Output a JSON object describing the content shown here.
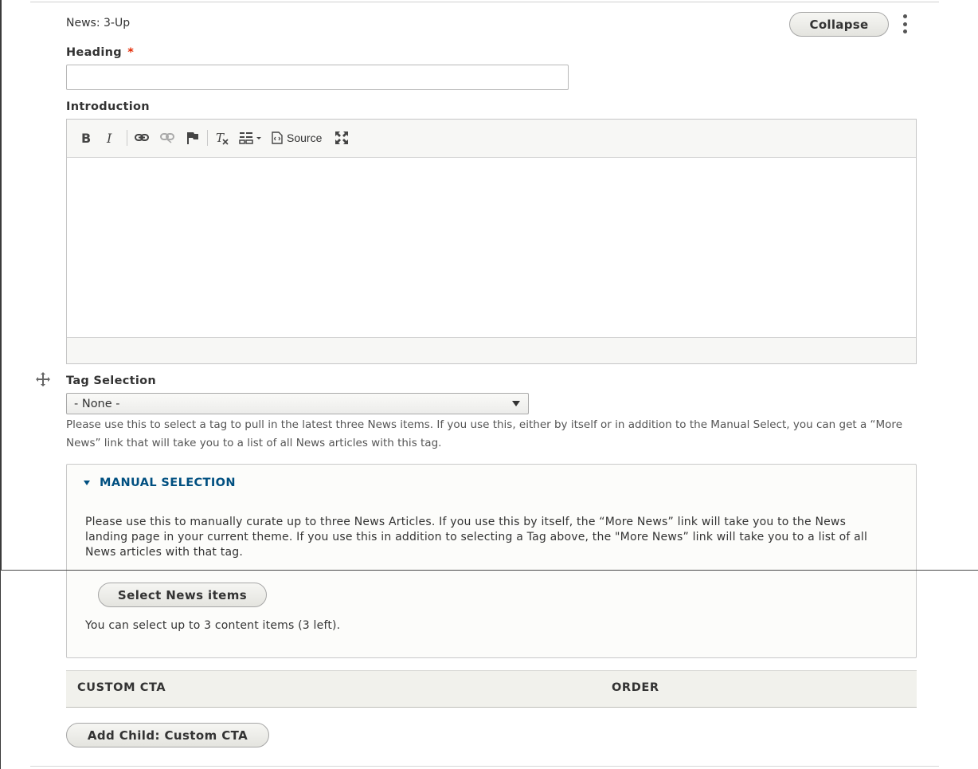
{
  "paragraph": {
    "type_label": "News: 3-Up",
    "collapse_label": "Collapse"
  },
  "heading": {
    "label": "Heading",
    "required_marker": "*",
    "value": ""
  },
  "introduction": {
    "label": "Introduction",
    "toolbar": {
      "bold_glyph": "B",
      "italic_glyph": "I",
      "source_label": "Source"
    }
  },
  "tag_selection": {
    "label": "Tag Selection",
    "selected": "- None -",
    "description": "Please use this to select a tag to pull in the latest three News items. If you use this, either by itself or in addition to the Manual Select, you can get a “More News” link that will take you to a list of all News articles with this tag."
  },
  "manual_selection": {
    "title": "MANUAL SELECTION",
    "description": "Please use this to manually curate up to three News Articles. If you use this by itself, the “More News” link will take you to the News landing page in your current theme. If you use this in addition to selecting a Tag above, the \"More News” link will take you to a list of all  News articles with that tag.",
    "select_button": "Select News items",
    "limit_text": "You can select up to 3 content items (3 left)."
  },
  "cta_table": {
    "col_custom": "CUSTOM CTA",
    "col_order": "ORDER"
  },
  "add_child_button": "Add Child: Custom CTA",
  "colors": {
    "link_blue": "#004f80",
    "required_red": "#e32700",
    "toolbar_bg": "#f7f7f5"
  }
}
